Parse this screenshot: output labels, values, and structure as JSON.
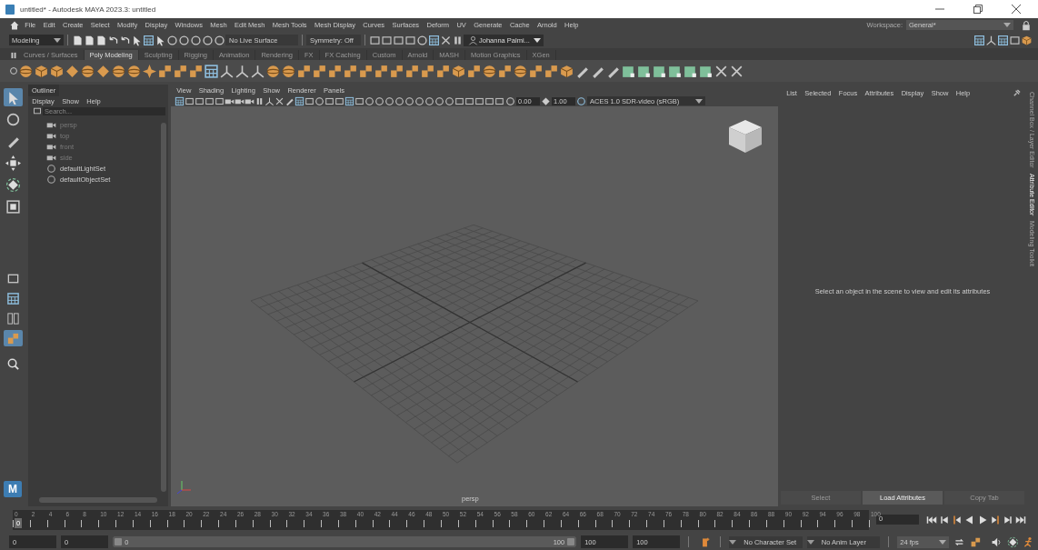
{
  "window": {
    "title": "untitled* - Autodesk MAYA 2023.3: untitled"
  },
  "menu_bar": {
    "items": [
      "File",
      "Edit",
      "Create",
      "Select",
      "Modify",
      "Display",
      "Windows",
      "Mesh",
      "Edit Mesh",
      "Mesh Tools",
      "Mesh Display",
      "Curves",
      "Surfaces",
      "Deform",
      "UV",
      "Generate",
      "Cache",
      "Arnold",
      "Help"
    ],
    "workspace_label": "Workspace:",
    "workspace": "General*"
  },
  "status_line": {
    "mode": "Modeling",
    "live_surface": "No Live Surface",
    "symmetry": "Symmetry: Off",
    "user": "Johanna Palmi..."
  },
  "shelf_tabs": [
    {
      "label": "Curves / Surfaces",
      "selected": false
    },
    {
      "label": "Poly Modeling",
      "selected": true
    },
    {
      "label": "Sculpting",
      "selected": false
    },
    {
      "label": "Rigging",
      "selected": false
    },
    {
      "label": "Animation",
      "selected": false
    },
    {
      "label": "Rendering",
      "selected": false
    },
    {
      "label": "FX",
      "selected": false
    },
    {
      "label": "FX Caching",
      "selected": false
    },
    {
      "label": "Custom",
      "selected": false
    },
    {
      "label": "Arnold",
      "selected": false
    },
    {
      "label": "MASH",
      "selected": false
    },
    {
      "label": "Motion Graphics",
      "selected": false
    },
    {
      "label": "XGen",
      "selected": false
    }
  ],
  "toolbox": [
    {
      "kind": "select",
      "selected": true
    },
    {
      "kind": "lasso",
      "selected": false
    },
    {
      "kind": "paint",
      "selected": false
    },
    {
      "kind": "move",
      "selected": false
    },
    {
      "kind": "rotate",
      "selected": false
    },
    {
      "kind": "scale",
      "selected": false
    }
  ],
  "layouts": [
    {
      "kind": "single",
      "selected": false
    },
    {
      "kind": "quad",
      "selected": false
    },
    {
      "kind": "split",
      "selected": false
    },
    {
      "kind": "outliner",
      "selected": true
    }
  ],
  "logo": "M",
  "outliner": {
    "title": "Outliner",
    "menus": [
      "Display",
      "Show",
      "Help"
    ],
    "search": {
      "placeholder": "Search..."
    },
    "items": [
      {
        "kind": "camera",
        "label": "persp",
        "dimmed": true
      },
      {
        "kind": "camera",
        "label": "top",
        "dimmed": true
      },
      {
        "kind": "camera",
        "label": "front",
        "dimmed": true
      },
      {
        "kind": "camera",
        "label": "side",
        "dimmed": true
      },
      {
        "kind": "set",
        "label": "defaultLightSet",
        "dimmed": false
      },
      {
        "kind": "set",
        "label": "defaultObjectSet",
        "dimmed": false
      }
    ]
  },
  "viewport": {
    "menus": [
      "View",
      "Shading",
      "Lighting",
      "Show",
      "Renderer",
      "Panels"
    ],
    "exposure": "0.00",
    "gamma": "1.00",
    "color_space": "ACES 1.0 SDR-video (sRGB)",
    "camera_label": "persp"
  },
  "attribute_editor": {
    "menus": [
      "List",
      "Selected",
      "Focus",
      "Attributes",
      "Display",
      "Show",
      "Help"
    ],
    "message": "Select an object in the scene to view and edit its attributes",
    "buttons": [
      {
        "label": "Select",
        "disabled": true
      },
      {
        "label": "Load Attributes",
        "disabled": false
      },
      {
        "label": "Copy Tab",
        "disabled": true
      }
    ]
  },
  "side_tabs": [
    {
      "label": "Channel Box / Layer Editor",
      "selected": false
    },
    {
      "label": "Attribute Editor",
      "selected": true
    },
    {
      "label": "Modeling Toolkit",
      "selected": false
    }
  ],
  "timeline": {
    "ticks": [
      "0",
      "2",
      "4",
      "6",
      "8",
      "10",
      "12",
      "14",
      "16",
      "18",
      "20",
      "22",
      "24",
      "26",
      "28",
      "30",
      "32",
      "34",
      "36",
      "38",
      "40",
      "42",
      "44",
      "46",
      "48",
      "50",
      "52",
      "54",
      "56",
      "58",
      "60",
      "62",
      "64",
      "66",
      "68",
      "70",
      "72",
      "74",
      "76",
      "78",
      "80",
      "82",
      "84",
      "86",
      "88",
      "90",
      "92",
      "94",
      "96",
      "98",
      "100"
    ],
    "playhead": "0",
    "level": 0,
    "current_frame": "0"
  },
  "range": {
    "start": "0",
    "playback_start": "0",
    "slider_start": "0",
    "slider_end": "100",
    "level": 1,
    "playback_end": "100",
    "end": "100",
    "character_set": "No Character Set",
    "anim_layer": "No Anim Layer",
    "fps": "24 fps"
  }
}
